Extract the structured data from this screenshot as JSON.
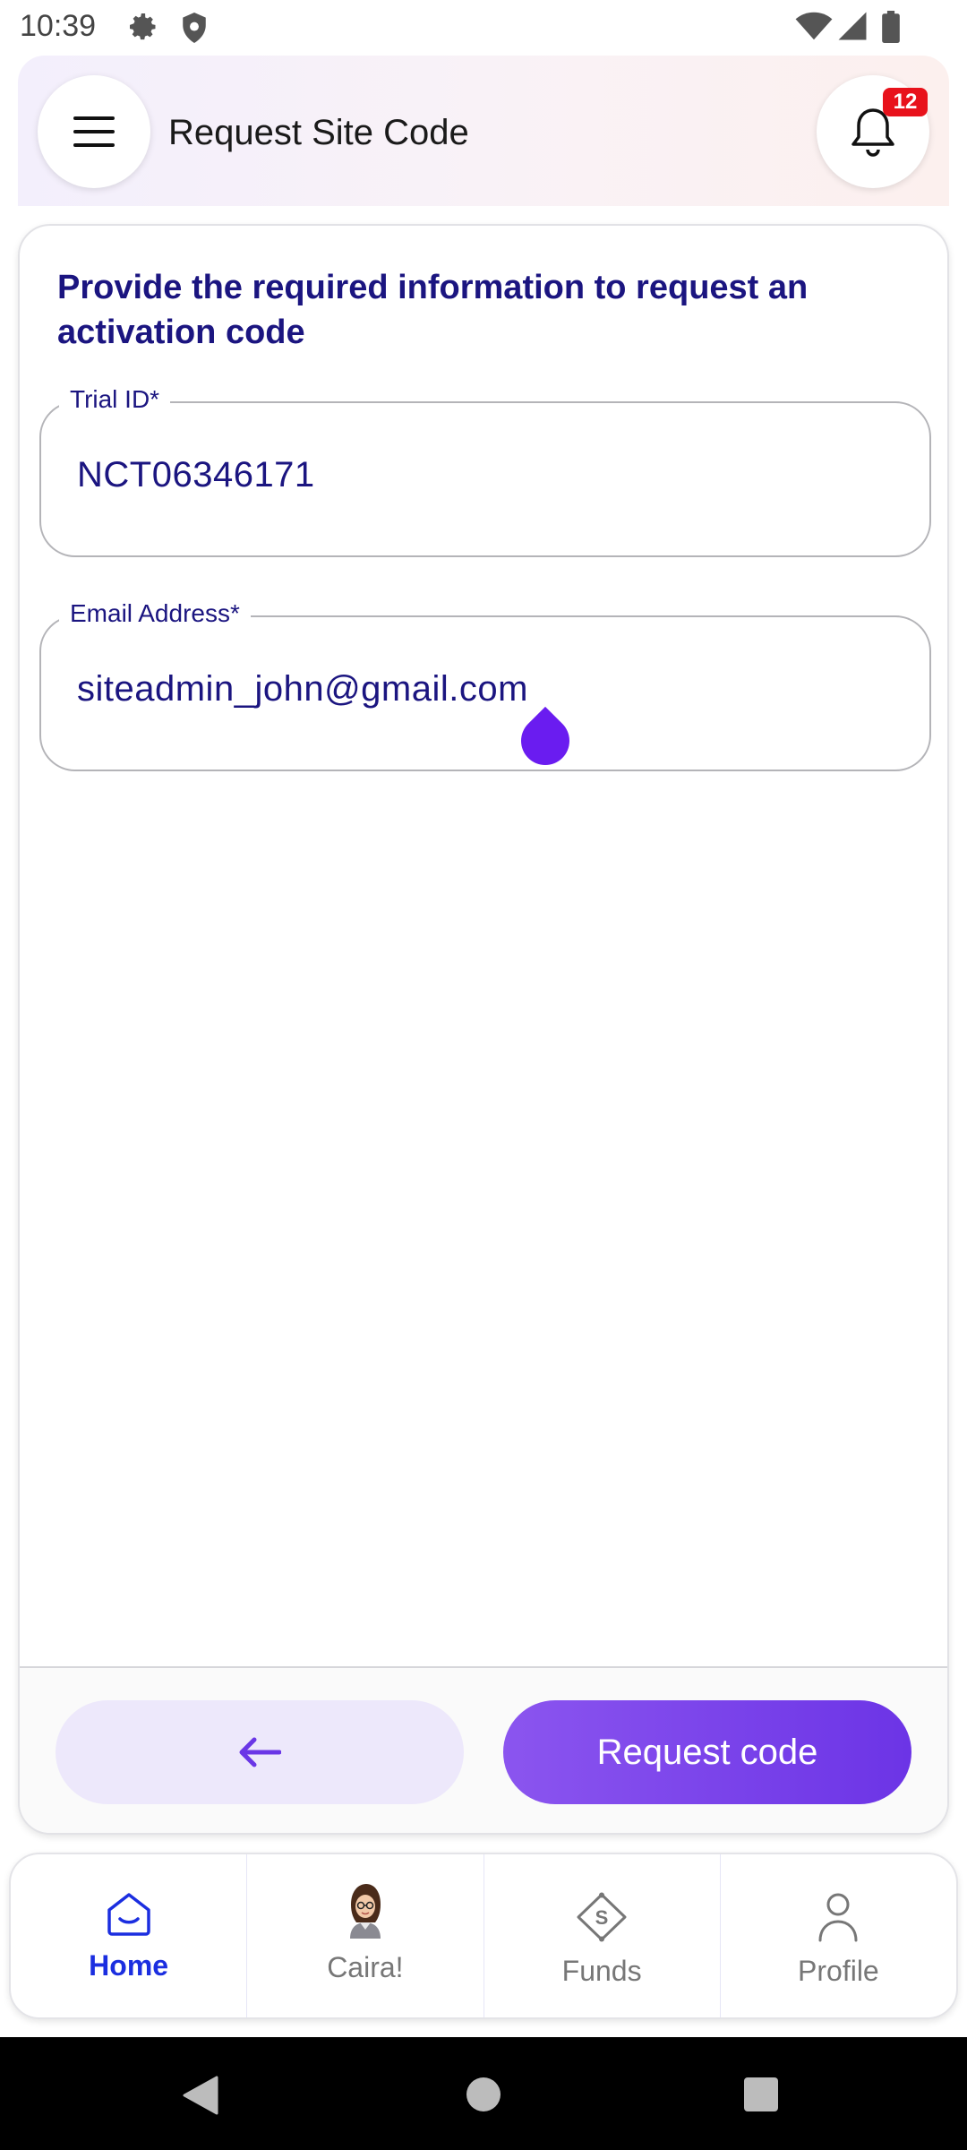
{
  "status_bar": {
    "time": "10:39",
    "icons": [
      "settings-gear-icon",
      "shield-icon",
      "wifi-icon",
      "cell-signal-icon",
      "battery-icon"
    ]
  },
  "header": {
    "title": "Request Site Code",
    "menu_icon": "hamburger-menu-icon",
    "notification_icon": "bell-icon",
    "notification_count": "12"
  },
  "form": {
    "heading": "Provide the required information to request an activation code",
    "trial_id": {
      "label": "Trial ID*",
      "value": "NCT06346171"
    },
    "email": {
      "label": "Email Address*",
      "value": "siteadmin_john@gmail.com"
    }
  },
  "actions": {
    "back_icon": "arrow-left-icon",
    "request_label": "Request code"
  },
  "bottom_nav": {
    "items": [
      {
        "label": "Home",
        "icon": "home-icon",
        "active": true
      },
      {
        "label": "Caira!",
        "icon": "assistant-avatar-icon",
        "active": false
      },
      {
        "label": "Funds",
        "icon": "funds-icon",
        "active": false
      },
      {
        "label": "Profile",
        "icon": "profile-icon",
        "active": false
      }
    ]
  },
  "system_nav": {
    "icons": [
      "back-triangle-icon",
      "home-circle-icon",
      "recents-square-icon"
    ]
  },
  "colors": {
    "primary_text": "#1b1580",
    "accent": "#6c34e6",
    "active_nav": "#1b2ee0",
    "badge": "#e8121b"
  }
}
